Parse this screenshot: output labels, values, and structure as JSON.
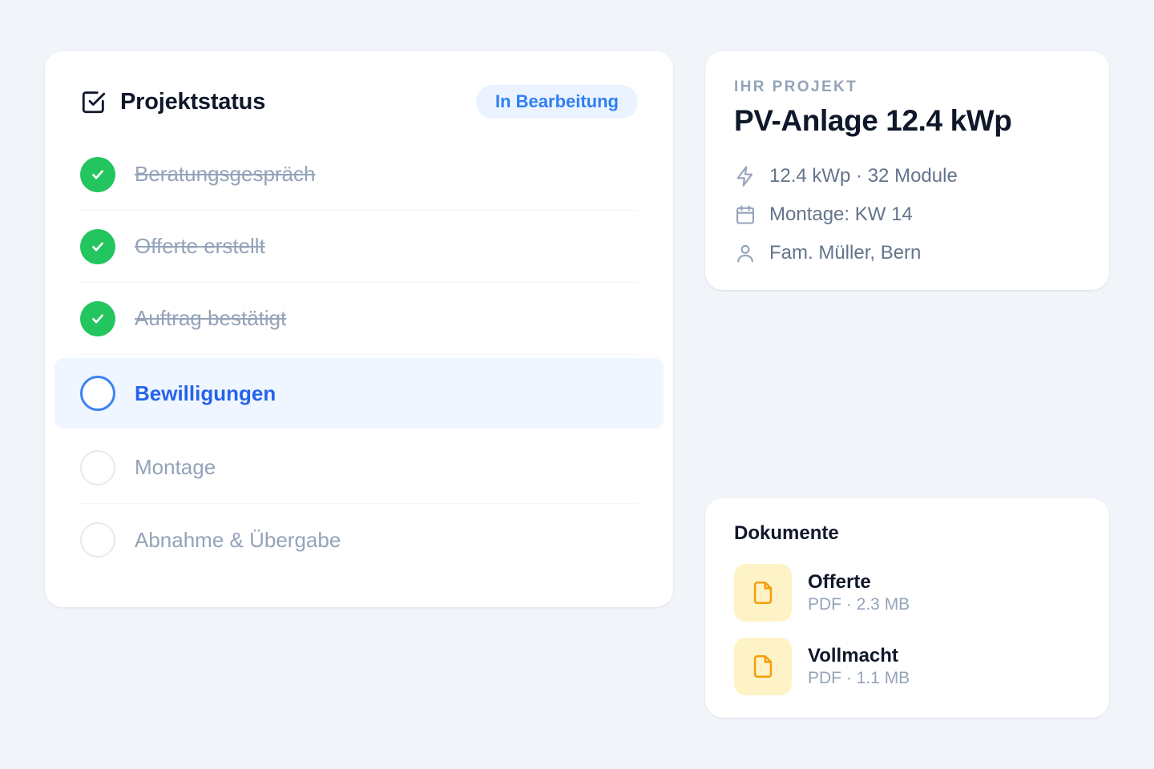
{
  "status": {
    "title": "Projektstatus",
    "badge": "In Bearbeitung",
    "steps": [
      {
        "label": "Beratungsgespräch",
        "state": "done"
      },
      {
        "label": "Offerte erstellt",
        "state": "done"
      },
      {
        "label": "Auftrag bestätigt",
        "state": "done"
      },
      {
        "label": "Bewilligungen",
        "state": "current"
      },
      {
        "label": "Montage",
        "state": "pending"
      },
      {
        "label": "Abnahme & Übergabe",
        "state": "pending"
      }
    ]
  },
  "project": {
    "eyebrow": "IHR PROJEKT",
    "title": "PV-Anlage 12.4 kWp",
    "meta": [
      {
        "icon": "lightning-icon",
        "text": "12.4 kWp · 32 Module"
      },
      {
        "icon": "calendar-icon",
        "text": "Montage: KW 14"
      },
      {
        "icon": "user-icon",
        "text": "Fam. Müller, Bern"
      }
    ]
  },
  "documents": {
    "title": "Dokumente",
    "items": [
      {
        "icon": "document-icon",
        "name": "Offerte",
        "meta": "PDF · 2.3 MB"
      },
      {
        "icon": "document-icon",
        "name": "Vollmacht",
        "meta": "PDF · 1.1 MB"
      }
    ]
  },
  "colors": {
    "background": "#f1f4f9",
    "done": "#22c55e",
    "current": "#2563eb",
    "badge_bg": "#eaf3ff",
    "doc_icon_bg": "#fef3c7",
    "doc_icon": "#f59e0b"
  }
}
